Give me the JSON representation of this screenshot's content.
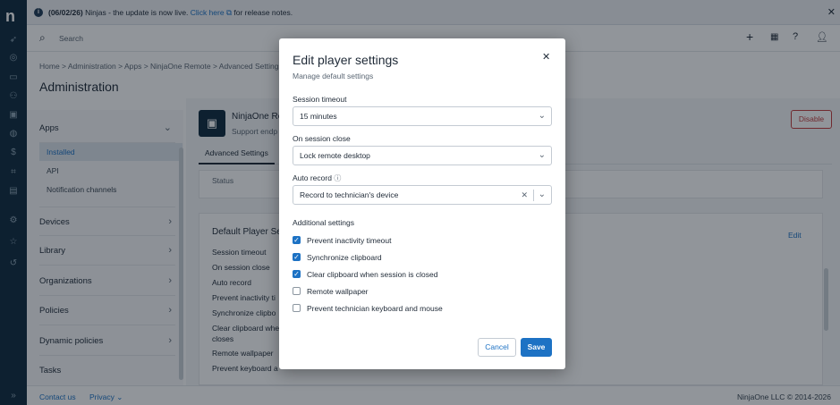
{
  "rail": {
    "logo": "n"
  },
  "banner": {
    "date": "(06/02/26)",
    "message": "Ninjas - the update is now live.",
    "link": "Click here",
    "suffix": "for release notes."
  },
  "topbar": {
    "search_placeholder": "Search"
  },
  "page": {
    "breadcrumb": "Home > Administration > Apps > NinjaOne Remote > Advanced Settings",
    "title": "Administration"
  },
  "sidebar": {
    "apps": "Apps",
    "sub": [
      "Installed",
      "API",
      "Notification channels"
    ],
    "items": [
      "Devices",
      "Library",
      "Organizations",
      "Policies",
      "Dynamic policies",
      "Tasks"
    ]
  },
  "app": {
    "name": "NinjaOne Re",
    "desc": "Support endp",
    "disable": "Disable",
    "tab": "Advanced Settings",
    "status": "Status",
    "card_title": "Default Player Se",
    "edit": "Edit",
    "rows": [
      "Session timeout",
      "On session close",
      "Auto record",
      "Prevent inactivity ti",
      "Synchronize clipbo",
      "Clear clipboard whe",
      "closes",
      "Remote wallpaper",
      "Prevent keyboard a"
    ]
  },
  "footer": {
    "contact": "Contact us",
    "privacy": "Privacy",
    "copyright": "NinjaOne LLC © 2014-2026"
  },
  "modal": {
    "title": "Edit player settings",
    "subtitle": "Manage default settings",
    "session_timeout_label": "Session timeout",
    "session_timeout_value": "15 minutes",
    "on_close_label": "On session close",
    "on_close_value": "Lock remote desktop",
    "auto_record_label": "Auto record",
    "auto_record_value": "Record to technician's device",
    "additional_label": "Additional settings",
    "checkboxes": [
      {
        "label": "Prevent inactivity timeout",
        "checked": true
      },
      {
        "label": "Synchronize clipboard",
        "checked": true
      },
      {
        "label": "Clear clipboard when session is closed",
        "checked": true
      },
      {
        "label": "Remote wallpaper",
        "checked": false
      },
      {
        "label": "Prevent technician keyboard and mouse",
        "checked": false
      }
    ],
    "cancel": "Cancel",
    "save": "Save"
  },
  "colors": {
    "rail": "#102b3e",
    "primary": "#1d72c4",
    "danger": "#c43d3d"
  }
}
